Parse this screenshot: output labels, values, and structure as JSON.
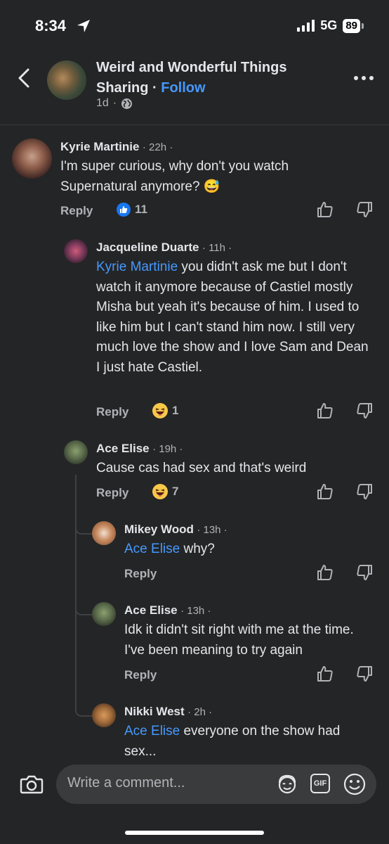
{
  "status": {
    "time": "8:34",
    "network": "5G",
    "battery": "89"
  },
  "header": {
    "group_name": "Weird and Wonderful Things Sharing",
    "separator": "·",
    "follow_label": "Follow",
    "age": "1d",
    "meta_sep": "·"
  },
  "comments": [
    {
      "name": "Kyrie Martinie",
      "time": "· 22h ·",
      "mention": "",
      "text": "I'm super curious, why don't you watch Supernatural anymore? 😅",
      "reply": "Reply",
      "reaction_count": "11"
    },
    {
      "name": "Jacqueline Duarte",
      "time": "· 11h ·",
      "mention": "Kyrie Martinie",
      "text": " you didn't ask me but I don't watch it anymore because of Castiel mostly Misha but yeah it's because of him. I used to like him but I can't stand him now. I still very much love the show and I love Sam and Dean I just hate Castiel.",
      "reply": "Reply",
      "reaction_count": "1"
    },
    {
      "name": "Ace Elise",
      "time": "· 19h ·",
      "mention": "",
      "text": "Cause cas had sex and that's weird",
      "reply": "Reply",
      "reaction_count": "7"
    },
    {
      "name": "Mikey Wood",
      "time": "· 13h ·",
      "mention": "Ace Elise",
      "text": " why?",
      "reply": "Reply",
      "reaction_count": ""
    },
    {
      "name": "Ace Elise",
      "time": "· 13h ·",
      "mention": "",
      "text": "Idk it didn't sit right with me at the time. I've been meaning to try again",
      "reply": "Reply",
      "reaction_count": ""
    },
    {
      "name": "Nikki West",
      "time": "· 2h ·",
      "mention": "Ace Elise",
      "text": " everyone on the show had sex...",
      "reply": "",
      "reaction_count": ""
    }
  ],
  "composer": {
    "placeholder": "Write a comment...",
    "gif_label": "GIF"
  },
  "colors": {
    "background": "#242526",
    "link": "#4599ff",
    "like_blue": "#1877f2"
  }
}
